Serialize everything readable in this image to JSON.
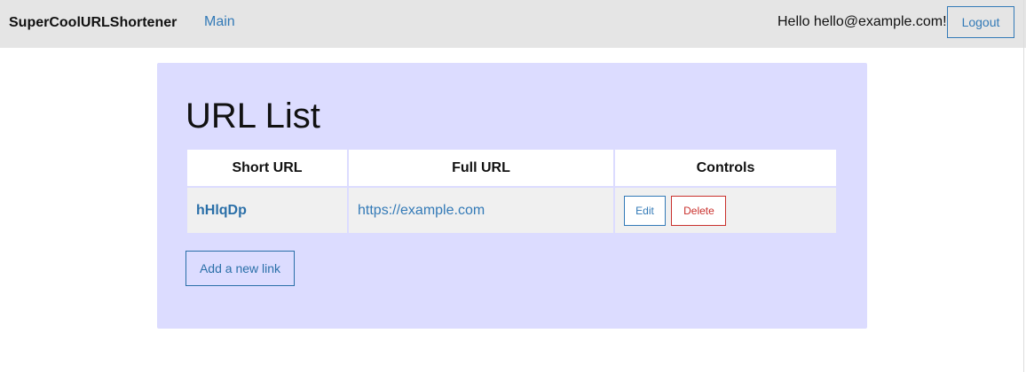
{
  "navbar": {
    "brand": "SuperCoolURLShortener",
    "main_link": "Main",
    "greeting": "Hello hello@example.com!",
    "logout_label": "Logout"
  },
  "main": {
    "title": "URL List",
    "table": {
      "headers": [
        "Short URL",
        "Full URL",
        "Controls"
      ],
      "rows": [
        {
          "short_url": "hHlqDp",
          "full_url": "https://example.com",
          "edit_label": "Edit",
          "delete_label": "Delete"
        }
      ]
    },
    "add_link_label": "Add a new link"
  },
  "colors": {
    "navbar_bg": "#e5e5e5",
    "panel_bg": "#dcdcff",
    "link": "#337ab7",
    "danger": "#c9302c"
  }
}
